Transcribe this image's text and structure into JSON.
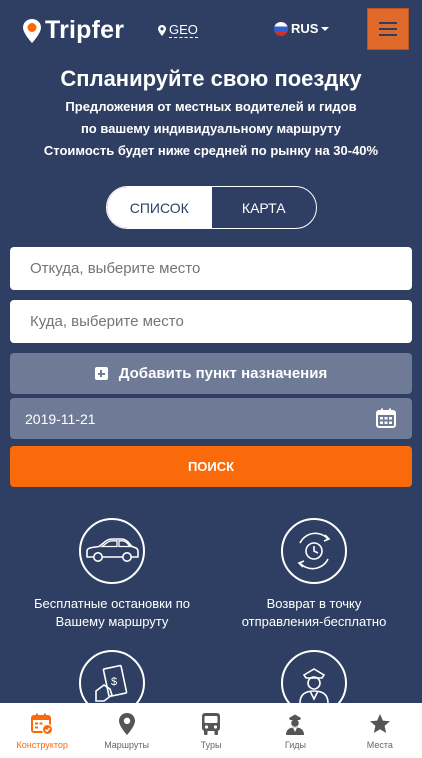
{
  "header": {
    "logo_text": "Tripfer",
    "geo_label": "GEO",
    "lang_label": "RUS"
  },
  "hero": {
    "title": "Спланируйте свою поездку",
    "line1": "Предложения от местных водителей и гидов",
    "line2": "по вашему индивидуальному маршруту",
    "line3": "Стоимость будет ниже средней по рынку на 30-40%"
  },
  "view_toggle": {
    "list_label": "СПИСОК",
    "map_label": "КАРТА",
    "selected": "СПИСОК"
  },
  "form": {
    "from_placeholder": "Откуда, выберите место",
    "to_placeholder": "Куда, выберите место",
    "add_destination_label": "Добавить пункт назначения",
    "date_value": "2019-11-21",
    "search_label": "ПОИСК"
  },
  "features": [
    {
      "icon": "car-icon",
      "line1": "Бесплатные остановки по",
      "line2": "Вашему маршруту"
    },
    {
      "icon": "return-clock-icon",
      "line1": "Возврат в точку",
      "line2": "отправления-бесплатно"
    },
    {
      "icon": "money-hand-icon",
      "line1": "",
      "line2": ""
    },
    {
      "icon": "driver-icon",
      "line1": "",
      "line2": ""
    }
  ],
  "bottom_nav": [
    {
      "label": "Конструктор",
      "icon": "calendar-icon",
      "active": true
    },
    {
      "label": "Маршруты",
      "icon": "map-pin-icon",
      "active": false
    },
    {
      "label": "Туры",
      "icon": "bus-icon",
      "active": false
    },
    {
      "label": "Гиды",
      "icon": "guide-icon",
      "active": false
    },
    {
      "label": "Места",
      "icon": "star-icon",
      "active": false
    }
  ],
  "colors": {
    "background": "#2f3f63",
    "accent_orange": "#fb6a0a",
    "menu_button": "#e06a2c",
    "muted_field": "#6e7a96"
  }
}
